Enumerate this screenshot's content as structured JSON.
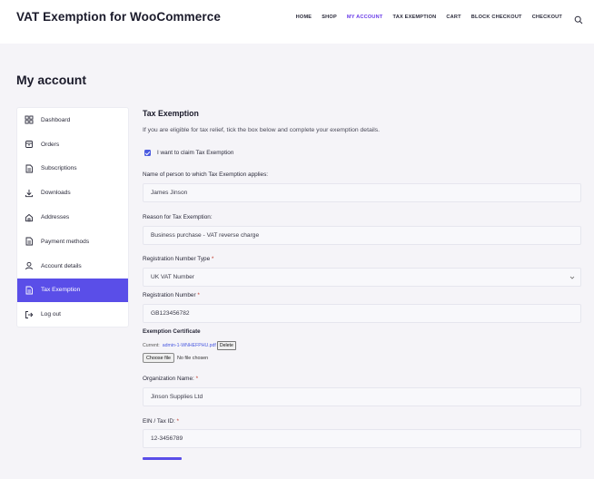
{
  "site": {
    "title": "VAT Exemption for WooCommerce"
  },
  "nav": {
    "items": [
      "HOME",
      "SHOP",
      "MY ACCOUNT",
      "TAX EXEMPTION",
      "CART",
      "BLOCK CHECKOUT",
      "CHECKOUT"
    ],
    "active": "MY ACCOUNT",
    "search_icon": "search-icon"
  },
  "page": {
    "title": "My account"
  },
  "sidebar": {
    "items": [
      {
        "label": "Dashboard",
        "icon": "grid-icon"
      },
      {
        "label": "Orders",
        "icon": "box-icon"
      },
      {
        "label": "Subscriptions",
        "icon": "document-icon"
      },
      {
        "label": "Downloads",
        "icon": "download-icon"
      },
      {
        "label": "Addresses",
        "icon": "home-icon"
      },
      {
        "label": "Payment methods",
        "icon": "document-icon"
      },
      {
        "label": "Account details",
        "icon": "user-icon"
      },
      {
        "label": "Tax Exemption",
        "icon": "document-icon"
      },
      {
        "label": "Log out",
        "icon": "logout-icon"
      }
    ],
    "active": "Tax Exemption"
  },
  "form": {
    "title": "Tax Exemption",
    "intro": "If you are eligible for tax relief, tick the box below and complete your exemption details.",
    "claim_label": "I want to claim Tax Exemption",
    "claim_checked": true,
    "name_label": "Name of person to which Tax Exemption applies:",
    "name_value": "James Jinson",
    "reason_label": "Reason for Tax Exemption:",
    "reason_value": "Business purchase - VAT reverse charge",
    "reg_type_label": "Registration Number Type",
    "reg_type_value": "UK VAT Number",
    "reg_number_label": "Registration Number",
    "reg_number_value": "GB123456782",
    "cert_label": "Exemption Certificate",
    "cert_current_prefix": "Current:",
    "cert_current_file": "admin-1-WNHEFPHU.pdf",
    "cert_delete_label": "Delete",
    "choose_file_label": "Choose file",
    "no_file_text": "No file chosen",
    "org_label": "Organization Name:",
    "org_value": "Jinson Supplies Ltd",
    "ein_label": "EIN / Tax ID:",
    "ein_value": "12-3456789",
    "required_mark": "*"
  },
  "colors": {
    "accent": "#5a4ee8",
    "active_nav": "#6a3de8",
    "checkbox": "#4a5ae0"
  }
}
